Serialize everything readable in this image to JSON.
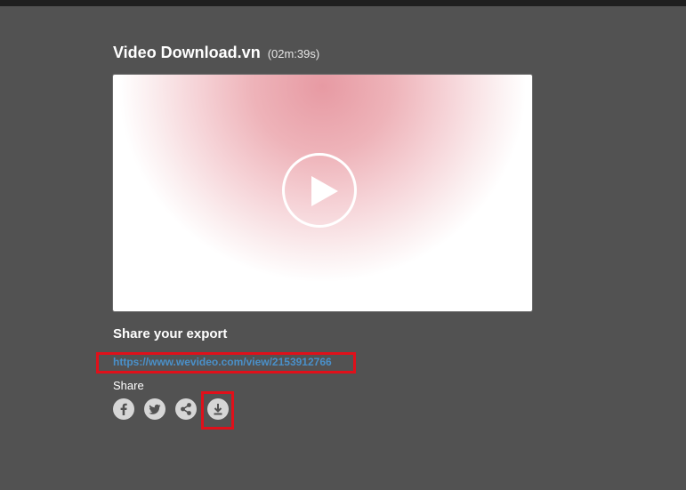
{
  "header": {
    "title": "Video Download.vn",
    "duration": "(02m:39s)"
  },
  "video": {
    "play_icon": "play-icon"
  },
  "share": {
    "heading": "Share your export",
    "link": "https://www.wevideo.com/view/2153912766",
    "label": "Share",
    "icons": [
      "facebook-icon",
      "twitter-icon",
      "share-icon",
      "download-icon"
    ]
  },
  "colors": {
    "background": "#525252",
    "link": "#4a90c9",
    "highlight": "#e0101a",
    "icon": "#d6d6d6"
  }
}
